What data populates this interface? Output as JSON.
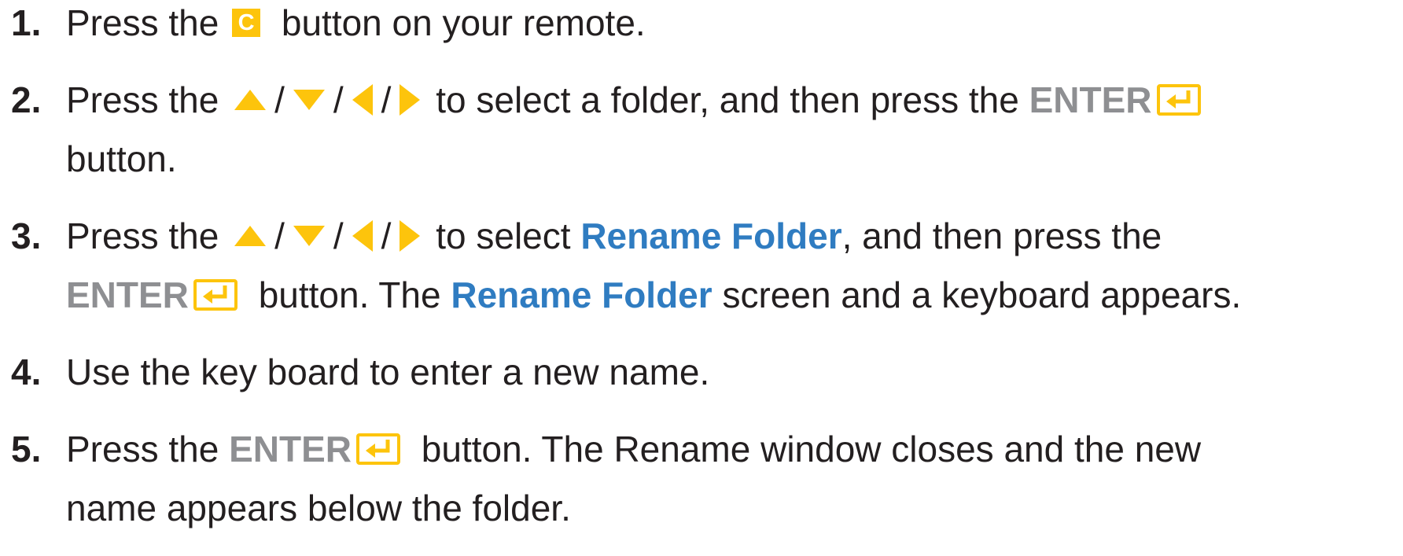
{
  "colors": {
    "text": "#231f20",
    "accent_blue": "#2f7cc1",
    "enter_gray": "#8e8f92",
    "icon_yellow": "#fdc40c"
  },
  "icons": {
    "c_button": "c-button-icon",
    "up": "up-arrow-icon",
    "down": "down-arrow-icon",
    "left": "left-arrow-icon",
    "right": "right-arrow-icon",
    "enter": "enter-icon"
  },
  "steps": [
    {
      "number": "1.",
      "press_the": "Press the",
      "c_label": "C",
      "rest": "button on your remote."
    },
    {
      "number": "2.",
      "press_the": "Press the",
      "slash": "/",
      "select_text": "to select a folder, and then press the",
      "enter_label": "ENTER",
      "button_word": "button."
    },
    {
      "number": "3.",
      "press_the": "Press the",
      "slash": "/",
      "select_prefix": "to select",
      "rename_folder": "Rename Folder",
      "then_press": ", and then press the",
      "enter_label": "ENTER",
      "button_the": "button. The",
      "rename_folder_2": "Rename Folder",
      "screen_text": "screen and a keyboard appears."
    },
    {
      "number": "4.",
      "text": "Use the key board to enter a new name."
    },
    {
      "number": "5.",
      "press_the": "Press the",
      "enter_label": "ENTER",
      "rest_line1": "button. The Rename window closes and the new",
      "rest_line2": "name appears below the folder."
    }
  ]
}
